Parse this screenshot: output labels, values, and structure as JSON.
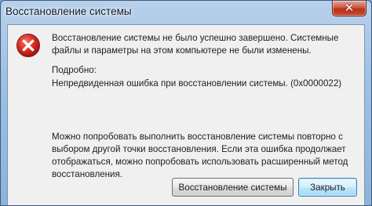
{
  "window": {
    "title": "Восстановление системы",
    "close_glyph": "✕"
  },
  "dialog": {
    "icon": "error-icon",
    "message": "Восстановление системы не было успешно завершено. Системные файлы и параметры на этом компьютере не были изменены.",
    "details_label": "Подробно:",
    "details_text": "Непредвиденная ошибка при восстановлении системы. (0x0000022)",
    "hint": "Можно попробовать выполнить восстановление системы повторно с выбором другой точки восстановления. Если эта ошибка продолжает отображаться, можно попробовать использовать расширенный метод восстановления."
  },
  "buttons": {
    "restore_label": "Восстановление системы",
    "close_label": "Закрыть"
  },
  "colors": {
    "error_red": "#d42a1f",
    "title_bar": "#9ec0e3",
    "dialog_bg": "#f0f0f0"
  }
}
